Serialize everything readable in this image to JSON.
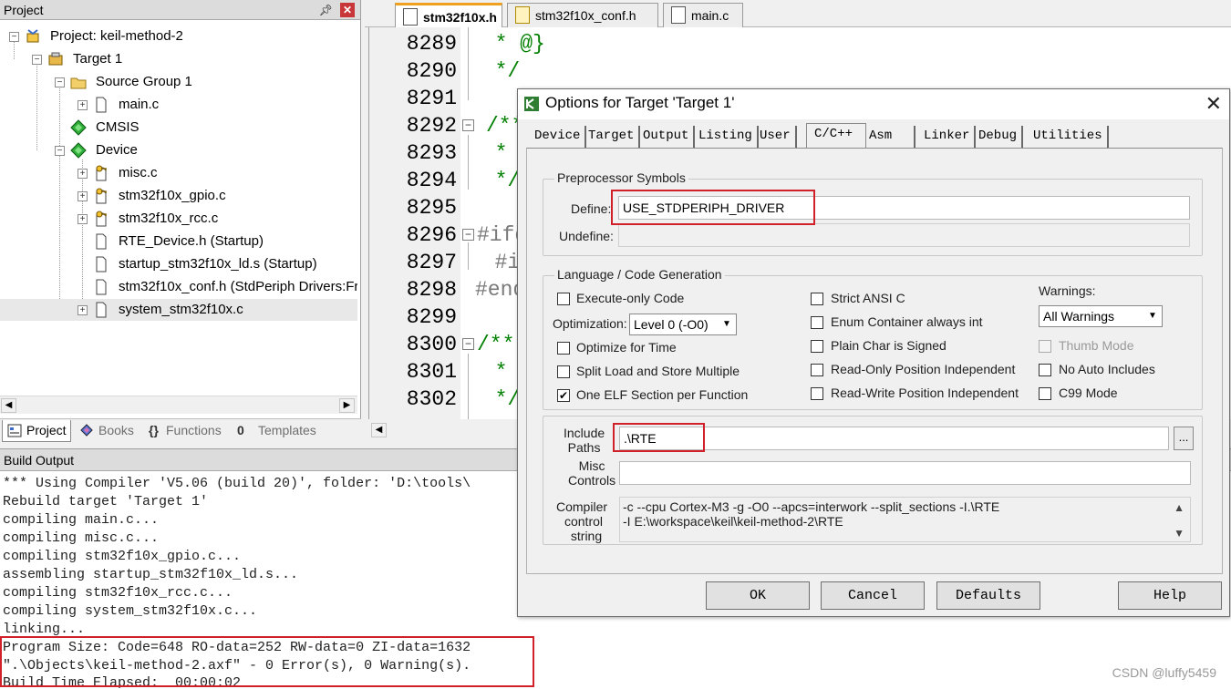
{
  "project_panel": {
    "title": "Project",
    "tree": [
      {
        "label": "Project: keil-method-2",
        "level": 0,
        "icon": "project-icon"
      },
      {
        "label": "Target 1",
        "level": 1,
        "icon": "target-icon"
      },
      {
        "label": "Source Group 1",
        "level": 2,
        "icon": "folder-icon"
      },
      {
        "label": "main.c",
        "level": 3,
        "icon": "file-icon"
      },
      {
        "label": "CMSIS",
        "level": 2,
        "icon": "component-icon"
      },
      {
        "label": "Device",
        "level": 2,
        "icon": "component-icon"
      },
      {
        "label": "misc.c",
        "level": 3,
        "icon": "key-file-icon"
      },
      {
        "label": "stm32f10x_gpio.c",
        "level": 3,
        "icon": "key-file-icon"
      },
      {
        "label": "stm32f10x_rcc.c",
        "level": 3,
        "icon": "key-file-icon"
      },
      {
        "label": "RTE_Device.h (Startup)",
        "level": 3,
        "icon": "file-icon"
      },
      {
        "label": "startup_stm32f10x_ld.s (Startup)",
        "level": 3,
        "icon": "file-icon"
      },
      {
        "label": "stm32f10x_conf.h (StdPeriph Drivers:Framework)",
        "level": 3,
        "icon": "file-icon"
      },
      {
        "label": "system_stm32f10x.c",
        "level": 3,
        "icon": "file-icon"
      }
    ],
    "tabs": [
      "Project",
      "Books",
      "Functions",
      "Templates"
    ],
    "tab_icons": [
      "{}",
      "0"
    ]
  },
  "editor": {
    "tabs": [
      "stm32f10x.h",
      "stm32f10x_conf.h",
      "main.c"
    ],
    "lines": [
      {
        "num": "8289",
        "text": "  * @}"
      },
      {
        "num": "8290",
        "text": "  */"
      },
      {
        "num": "8291",
        "text": ""
      },
      {
        "num": "8292",
        "text": "/**"
      },
      {
        "num": "8293",
        "text": "  *"
      },
      {
        "num": "8294",
        "text": "  */"
      },
      {
        "num": "8295",
        "text": ""
      },
      {
        "num": "8296",
        "text": "#ifd"
      },
      {
        "num": "8297",
        "text": "  #i"
      },
      {
        "num": "8298",
        "text": "#end"
      },
      {
        "num": "8299",
        "text": ""
      },
      {
        "num": "8300",
        "text": "/**"
      },
      {
        "num": "8301",
        "text": "  *"
      },
      {
        "num": "8302",
        "text": "  */"
      }
    ]
  },
  "build_output": {
    "title": "Build Output",
    "lines": [
      "*** Using Compiler 'V5.06 (build 20)', folder: 'D:\\tools\\",
      "Rebuild target 'Target 1'",
      "compiling main.c...",
      "compiling misc.c...",
      "compiling stm32f10x_gpio.c...",
      "assembling startup_stm32f10x_ld.s...",
      "compiling stm32f10x_rcc.c...",
      "compiling system_stm32f10x.c...",
      "linking...",
      "Program Size: Code=648 RO-data=252 RW-data=0 ZI-data=1632",
      "\".\\Objects\\keil-method-2.axf\" - 0 Error(s), 0 Warning(s).",
      "Build Time Elapsed:  00:00:02"
    ]
  },
  "dialog": {
    "title": "Options for Target 'Target 1'",
    "close": "✕",
    "tabs": [
      "Device",
      "Target",
      "Output",
      "Listing",
      "User",
      "C/C++",
      "Asm",
      "Linker",
      "Debug",
      "Utilities"
    ],
    "active_tab": "C/C++",
    "preprocessor": {
      "group": "Preprocessor Symbols",
      "define_label": "Define:",
      "define_value": "USE_STDPERIPH_DRIVER",
      "undefine_label": "Undefine:",
      "undefine_value": ""
    },
    "language": {
      "group": "Language / Code Generation",
      "execute_only": "Execute-only Code",
      "optimization_label": "Optimization:",
      "optimization_value": "Level 0 (-O0)",
      "optimize_time": "Optimize for Time",
      "split_load": "Split Load and Store Multiple",
      "one_elf": "One ELF Section per Function",
      "strict_ansi": "Strict ANSI C",
      "enum_container": "Enum Container always int",
      "plain_char": "Plain Char is Signed",
      "ro_pi": "Read-Only Position Independent",
      "rw_pi": "Read-Write Position Independent",
      "warnings_label": "Warnings:",
      "warnings_value": "All Warnings",
      "thumb_mode": "Thumb Mode",
      "no_auto_includes": "No Auto Includes",
      "c99_mode": "C99 Mode",
      "checkmark": "✔"
    },
    "include_paths_label": [
      "Include",
      "Paths"
    ],
    "include_paths_value": ".\\RTE",
    "browse_label": "...",
    "misc_controls_label": [
      "Misc",
      "Controls"
    ],
    "misc_controls_value": "",
    "compiler_string_label": [
      "Compiler",
      "control",
      "string"
    ],
    "compiler_string_lines": [
      "-c --cpu Cortex-M3 -g -O0 --apcs=interwork --split_sections -I.\\RTE",
      "-I E:\\workspace\\keil\\keil-method-2\\RTE"
    ],
    "buttons": {
      "ok": "OK",
      "cancel": "Cancel",
      "defaults": "Defaults",
      "help": "Help"
    }
  },
  "watermark": "CSDN @luffy5459"
}
